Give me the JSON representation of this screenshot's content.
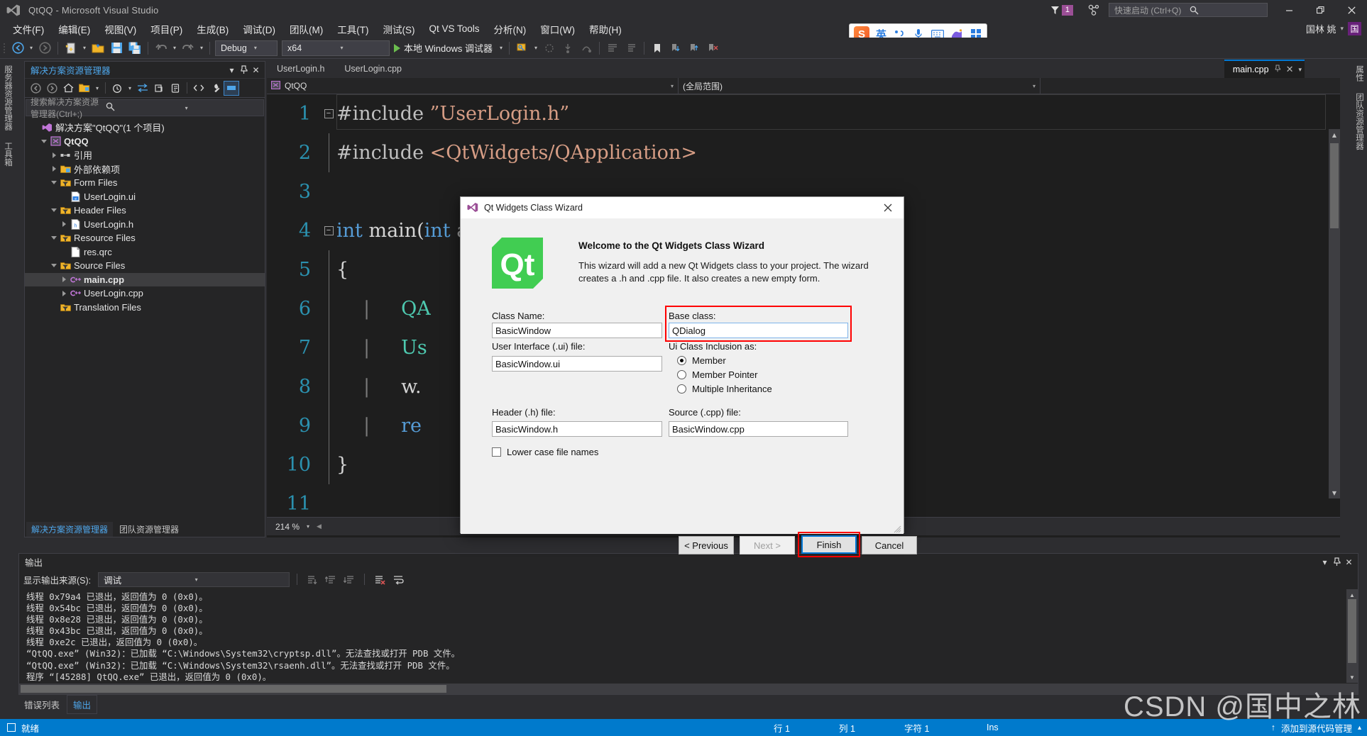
{
  "window": {
    "title": "QtQQ - Microsoft Visual Studio",
    "minimize_label": "—",
    "restore_label": "❐",
    "close_label": "✕",
    "notification_count": "1"
  },
  "quick_launch": {
    "placeholder": "快速启动 (Ctrl+Q)"
  },
  "account": {
    "name": "国林 姚",
    "avatar_initial": "国",
    "caret": "▾"
  },
  "menu": {
    "items": [
      "文件(F)",
      "编辑(E)",
      "视图(V)",
      "项目(P)",
      "生成(B)",
      "调试(D)",
      "团队(M)",
      "工具(T)",
      "测试(S)",
      "Qt VS Tools",
      "分析(N)",
      "窗口(W)",
      "帮助(H)"
    ]
  },
  "toolbar": {
    "config": "Debug",
    "platform": "x64",
    "run_label": "本地 Windows 调试器",
    "caret": "▾"
  },
  "ime": {
    "lang": "英"
  },
  "side_rail": {
    "tabs": [
      "服务器资源管理器",
      "工具箱"
    ]
  },
  "right_rail": {
    "tabs": [
      "属性",
      "团队资源管理器"
    ]
  },
  "solution_explorer": {
    "title": "解决方案资源管理器",
    "search_placeholder": "搜索解决方案资源管理器(Ctrl+;)",
    "header_buttons": {
      "dropdown": "▾",
      "pin": "⚓",
      "close": "✕"
    },
    "tree": [
      {
        "label": "解决方案\"QtQQ\"(1 个项目)",
        "indent": 0,
        "twisty": "none",
        "icon": "solution-icon",
        "bold": false,
        "selected": false
      },
      {
        "label": "QtQQ",
        "indent": 1,
        "twisty": "down",
        "icon": "project-icon",
        "bold": true,
        "selected": false
      },
      {
        "label": "引用",
        "indent": 2,
        "twisty": "right",
        "icon": "references-icon",
        "bold": false,
        "selected": false
      },
      {
        "label": "外部依赖项",
        "indent": 2,
        "twisty": "right",
        "icon": "folder-ext-icon",
        "bold": false,
        "selected": false
      },
      {
        "label": "Form Files",
        "indent": 2,
        "twisty": "down",
        "icon": "filter-folder-icon",
        "bold": false,
        "selected": false
      },
      {
        "label": "UserLogin.ui",
        "indent": 3,
        "twisty": "none",
        "icon": "ui-file-icon",
        "bold": false,
        "selected": false
      },
      {
        "label": "Header Files",
        "indent": 2,
        "twisty": "down",
        "icon": "filter-folder-icon",
        "bold": false,
        "selected": false
      },
      {
        "label": "UserLogin.h",
        "indent": 3,
        "twisty": "right",
        "icon": "h-file-icon",
        "bold": false,
        "selected": false
      },
      {
        "label": "Resource Files",
        "indent": 2,
        "twisty": "down",
        "icon": "filter-folder-icon",
        "bold": false,
        "selected": false
      },
      {
        "label": "res.qrc",
        "indent": 3,
        "twisty": "none",
        "icon": "qrc-file-icon",
        "bold": false,
        "selected": false
      },
      {
        "label": "Source Files",
        "indent": 2,
        "twisty": "down",
        "icon": "filter-folder-icon",
        "bold": false,
        "selected": false
      },
      {
        "label": "main.cpp",
        "indent": 3,
        "twisty": "right",
        "icon": "cpp-file-icon",
        "bold": true,
        "selected": true
      },
      {
        "label": "UserLogin.cpp",
        "indent": 3,
        "twisty": "right",
        "icon": "cpp-file-icon",
        "bold": false,
        "selected": false
      },
      {
        "label": "Translation Files",
        "indent": 2,
        "twisty": "none",
        "icon": "filter-folder-icon",
        "bold": false,
        "selected": false
      }
    ],
    "bottom_tabs": [
      {
        "label": "解决方案资源管理器",
        "active": true
      },
      {
        "label": "团队资源管理器",
        "active": false
      }
    ]
  },
  "editor": {
    "tabs": [
      {
        "label": "UserLogin.h",
        "active": false
      },
      {
        "label": "UserLogin.cpp",
        "active": false
      }
    ],
    "active_doc": {
      "label": "main.cpp",
      "close": "✕",
      "caret": "▾"
    },
    "navbar": {
      "project": "QtQQ",
      "scope": "(全局范围)",
      "caret": "▾"
    },
    "zoom": "214 %",
    "lines": [
      {
        "no": "1",
        "fold": "minus",
        "text": "#include ”UserLogin.h”"
      },
      {
        "no": "2",
        "fold": "bar",
        "text": "#include <QtWidgets/QApplication>"
      },
      {
        "no": "3",
        "fold": "none",
        "text": ""
      },
      {
        "no": "4",
        "fold": "minus",
        "text": "int main(int argc, char *argv[])"
      },
      {
        "no": "5",
        "fold": "brace",
        "text": "{"
      },
      {
        "no": "6",
        "fold": "dash",
        "text": "QA"
      },
      {
        "no": "7",
        "fold": "dash",
        "text": "Us"
      },
      {
        "no": "8",
        "fold": "dash",
        "text": "w."
      },
      {
        "no": "9",
        "fold": "dash",
        "text": "re"
      },
      {
        "no": "10",
        "fold": "end",
        "text": "}"
      },
      {
        "no": "11",
        "fold": "none",
        "text": ""
      }
    ]
  },
  "output": {
    "title": "输出",
    "source_label": "显示输出来源(S):",
    "source_value": "调试",
    "caret": "▾",
    "header_buttons": {
      "dropdown": "▾",
      "pin": "⚓",
      "close": "✕"
    },
    "lines": [
      "线程 0x79a4 已退出，返回值为 0 (0x0)。",
      "线程 0x54bc 已退出，返回值为 0 (0x0)。",
      "线程 0x8e28 已退出，返回值为 0 (0x0)。",
      "线程 0x43bc 已退出，返回值为 0 (0x0)。",
      "线程 0xe2c 已退出，返回值为 0 (0x0)。",
      "“QtQQ.exe” (Win32)：已加载 “C:\\Windows\\System32\\cryptsp.dll”。无法查找或打开 PDB 文件。",
      "“QtQQ.exe” (Win32)：已加载 “C:\\Windows\\System32\\rsaenh.dll”。无法查找或打开 PDB 文件。",
      "程序 “[45288] QtQQ.exe” 已退出，返回值为 0 (0x0)。"
    ]
  },
  "bottom_tabs": [
    {
      "label": "错误列表",
      "active": false
    },
    {
      "label": "输出",
      "active": true
    }
  ],
  "statusbar": {
    "status": "就绪",
    "line": "行 1",
    "col": "列 1",
    "char": "字符 1",
    "insert_mode": "Ins",
    "source_control": "添加到源代码管理",
    "up_arrow": "▴",
    "plus": "↑"
  },
  "watermark": {
    "text": "CSDN @国中之林"
  },
  "dialog": {
    "title": "Qt Widgets Class Wizard",
    "close": "✕",
    "welcome_heading": "Welcome to the Qt Widgets Class Wizard",
    "welcome_body": "This wizard will add a new Qt Widgets class to your project. The wizard creates a .h and .cpp file. It also creates a new empty form.",
    "fields": {
      "class_name_label": "Class Name:",
      "class_name_value": "BasicWindow",
      "base_class_label": "Base class:",
      "base_class_value": "QDialog",
      "ui_file_label": "User Interface (.ui) file:",
      "ui_file_value": "BasicWindow.ui",
      "inclusion_label": "Ui Class Inclusion as:",
      "header_label": "Header (.h) file:",
      "header_value": "BasicWindow.h",
      "source_label": "Source (.cpp) file:",
      "source_value": "BasicWindow.cpp",
      "lowercase_label": "Lower case file names"
    },
    "radios": [
      {
        "label": "Member",
        "checked": true
      },
      {
        "label": "Member Pointer",
        "checked": false
      },
      {
        "label": "Multiple Inheritance",
        "checked": false
      }
    ],
    "buttons": {
      "previous": "< Previous",
      "next": "Next >",
      "finish": "Finish",
      "cancel": "Cancel"
    }
  },
  "colors": {
    "vs_dark_bg": "#2d2d30",
    "editor_bg": "#1e1e1e",
    "accent_blue": "#007acc",
    "link_blue": "#4ea6ea",
    "purple": "#68217a",
    "qt_green": "#41cd52",
    "highlight_red": "#ff0000"
  }
}
